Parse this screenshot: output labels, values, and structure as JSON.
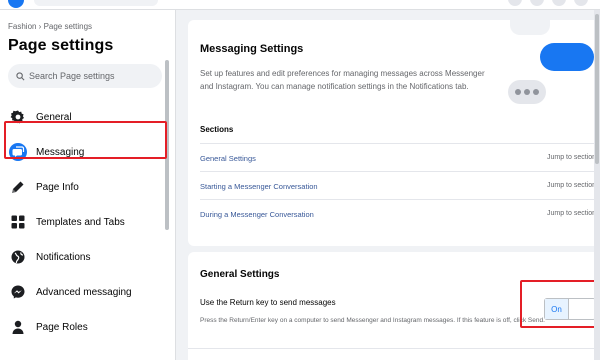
{
  "sidebar": {
    "breadcrumb": "Fashion › Page settings",
    "title": "Page settings",
    "search_placeholder": "Search Page settings",
    "items": [
      {
        "label": "General",
        "icon": "gear-icon"
      },
      {
        "label": "Messaging",
        "icon": "messenger-icon",
        "active": true
      },
      {
        "label": "Page Info",
        "icon": "pencil-icon"
      },
      {
        "label": "Templates and Tabs",
        "icon": "grid-icon"
      },
      {
        "label": "Notifications",
        "icon": "globe-icon"
      },
      {
        "label": "Advanced messaging",
        "icon": "messenger-bolt-icon"
      },
      {
        "label": "Page Roles",
        "icon": "person-icon"
      }
    ]
  },
  "messaging": {
    "title": "Messaging Settings",
    "description": "Set up features and edit preferences for managing messages across Messenger and Instagram. You can manage notification settings in the Notifications tab.",
    "sections_title": "Sections",
    "sections": [
      {
        "label": "General Settings",
        "jump": "Jump to section"
      },
      {
        "label": "Starting a Messenger Conversation",
        "jump": "Jump to section"
      },
      {
        "label": "During a Messenger Conversation",
        "jump": "Jump to section"
      }
    ]
  },
  "general_settings": {
    "title": "General Settings",
    "return_key_label": "Use the Return key to send messages",
    "return_key_help": "Press the Return/Enter key on a computer to send Messenger and Instagram messages. If this feature is off, click Send.",
    "toggle_label": "On"
  },
  "colors": {
    "accent": "#1877f2",
    "highlight": "#e41e26",
    "link": "#385898"
  }
}
